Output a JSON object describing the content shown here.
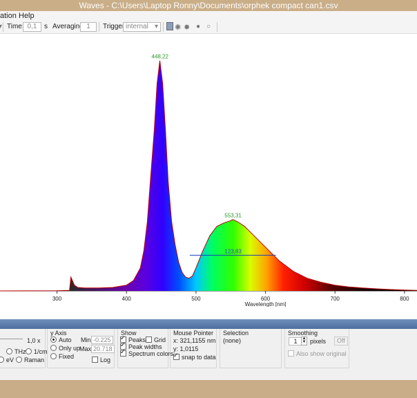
{
  "window": {
    "title": "Waves  -  C:\\Users\\Laptop Ronny\\Documents\\orphek compact can1.csv"
  },
  "menu": {
    "items": [
      "ation",
      "Help"
    ]
  },
  "toolbar": {
    "time_label": "Time:",
    "time_value": "0,1",
    "time_unit": "s",
    "averaging_label": "Averaging:",
    "averaging_value": "1",
    "trigger_label": "Trigger:",
    "trigger_value": "internal",
    "dropdown_glyph": "▾"
  },
  "chart_data": {
    "type": "line",
    "xlabel": "Wavelength [nm]",
    "ylabel": "",
    "x_ticks": [
      "300",
      "400",
      "500",
      "600",
      "700",
      "800"
    ],
    "xlim": [
      218,
      818
    ],
    "ylim": [
      0,
      21
    ],
    "annotations": [
      {
        "text": "448,22",
        "x": 448.22,
        "y": 20.0,
        "color": "#2a9a2a"
      },
      {
        "text": "553,31",
        "x": 553.31,
        "y": 6.2,
        "color": "#2a9a2a"
      },
      {
        "text": "123,83",
        "x": 553.31,
        "y": 3.1,
        "color": "#2a4ab8"
      }
    ],
    "fwhm": {
      "x_start": 491,
      "x_end": 615,
      "y": 3.1
    },
    "series": [
      {
        "x": [
          218,
          300,
          318,
          320,
          325,
          330,
          340,
          360,
          380,
          400,
          410,
          420,
          425,
          430,
          435,
          440,
          444,
          448,
          452,
          456,
          460,
          465,
          470,
          475,
          480,
          485,
          490,
          495,
          500,
          510,
          520,
          530,
          540,
          550,
          553,
          560,
          570,
          580,
          590,
          600,
          610,
          620,
          640,
          660,
          680,
          700,
          720,
          740,
          760,
          780,
          800,
          818
        ],
        "values": [
          0.0,
          0.02,
          0.05,
          1.2,
          0.5,
          0.3,
          0.25,
          0.25,
          0.3,
          0.5,
          0.9,
          2.0,
          3.5,
          6.0,
          10.0,
          14.0,
          18.0,
          20.0,
          18.0,
          14.0,
          9.5,
          6.0,
          4.0,
          2.5,
          1.6,
          1.2,
          1.1,
          1.3,
          2.0,
          3.5,
          4.8,
          5.6,
          5.9,
          6.1,
          6.2,
          6.0,
          5.6,
          5.0,
          4.4,
          3.8,
          3.2,
          2.6,
          1.7,
          1.1,
          0.75,
          0.5,
          0.35,
          0.25,
          0.18,
          0.12,
          0.08,
          0.05
        ]
      }
    ]
  },
  "axis_labels": {
    "y_axis_title": "y Axis",
    "auto": "Auto",
    "only_up": "Only up",
    "fixed": "Fixed",
    "min_label": "Min:",
    "min_value": "-0.225",
    "max_label": "Max:",
    "max_value": "20.718",
    "log": "Log",
    "zoom_value": "1,0 x",
    "thz": "THz",
    "per_cm": "1/cm",
    "ev": "eV",
    "raman": "Raman"
  },
  "show": {
    "title": "Show",
    "peaks": "Peaks",
    "grid": "Grid",
    "peak_widths": "Peak widths",
    "spectrum_colors": "Spectrum colors"
  },
  "mouse": {
    "title": "Mouse Pointer",
    "x": "x: 321,1155 nm",
    "y": "y: 1,0115",
    "snap": "snap to data"
  },
  "selection": {
    "title": "Selection",
    "value": "(none)"
  },
  "smoothing": {
    "title": "Smoothing",
    "value": "1",
    "unit": "pixels",
    "off_button": "Off",
    "also_show": "Also show original"
  }
}
